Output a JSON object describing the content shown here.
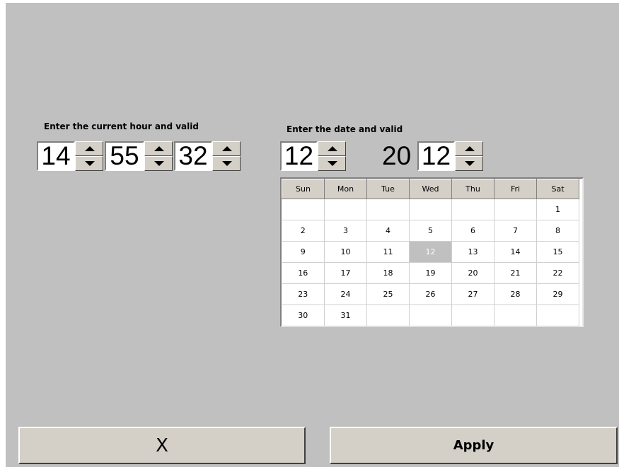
{
  "time": {
    "label": "Enter the current hour and valid",
    "hour": "14",
    "minute": "55",
    "second": "32"
  },
  "date": {
    "label": "Enter the date and valid",
    "month": "12",
    "year_prefix": "20",
    "year_suffix": "12"
  },
  "calendar": {
    "weekdays": [
      "Sun",
      "Mon",
      "Tue",
      "Wed",
      "Thu",
      "Fri",
      "Sat"
    ],
    "weeks": [
      [
        "",
        "",
        "",
        "",
        "",
        "",
        "1"
      ],
      [
        "2",
        "3",
        "4",
        "5",
        "6",
        "7",
        "8"
      ],
      [
        "9",
        "10",
        "11",
        "12",
        "13",
        "14",
        "15"
      ],
      [
        "16",
        "17",
        "18",
        "19",
        "20",
        "21",
        "22"
      ],
      [
        "23",
        "24",
        "25",
        "26",
        "27",
        "28",
        "29"
      ],
      [
        "30",
        "31",
        "",
        "",
        "",
        "",
        ""
      ]
    ],
    "selected_day": "12",
    "selected_color": "#c0c0c0"
  },
  "buttons": {
    "cancel_label": "X",
    "apply_label": "Apply"
  },
  "colors": {
    "background": "#c0c0c0",
    "button_face": "#d4d0c8"
  }
}
